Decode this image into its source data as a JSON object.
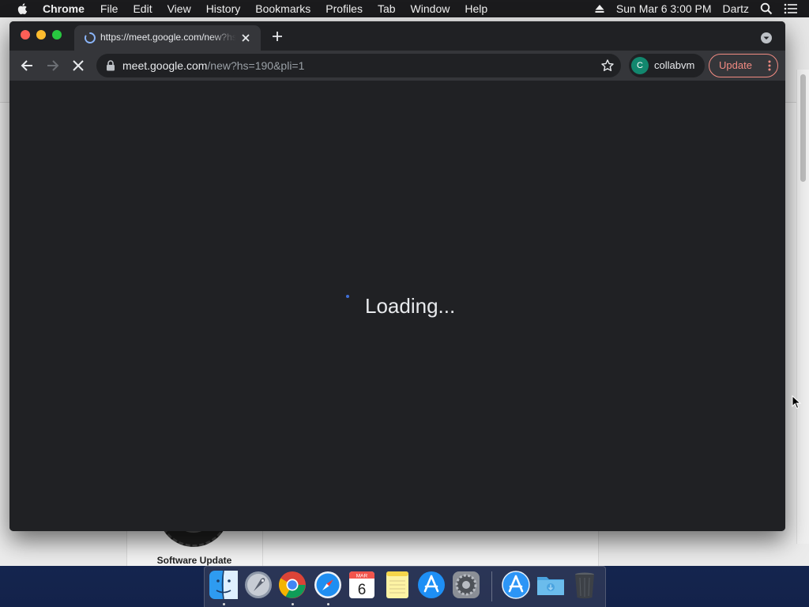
{
  "menubar": {
    "app_name": "Chrome",
    "items": [
      "File",
      "Edit",
      "View",
      "History",
      "Bookmarks",
      "Profiles",
      "Tab",
      "Window",
      "Help"
    ],
    "clock": "Sun Mar 6  3:00 PM",
    "user": "Dartz"
  },
  "browser": {
    "tab": {
      "title": "https://meet.google.com/new?hs=190&pli=1"
    },
    "omnibox": {
      "host": "meet.google.com",
      "path": "/new?hs=190&pli=1"
    },
    "profile": {
      "initial": "C",
      "name": "collabvm"
    },
    "update_label": "Update",
    "page": {
      "loading_text": "Loading..."
    }
  },
  "background_window": {
    "label": "Software Update"
  },
  "dock": {
    "calendar": {
      "month": "MAR",
      "day": "6"
    },
    "apps": [
      "finder-icon",
      "launchpad-icon",
      "chrome-icon",
      "safari-icon",
      "calendar-icon",
      "notes-icon",
      "app-store-icon",
      "system-preferences-icon",
      "app-store-icon",
      "downloads-folder-icon",
      "trash-icon"
    ]
  },
  "colors": {
    "chrome_frame": "#202124",
    "chrome_toolbar": "#35363a",
    "update_accent": "#f28b82",
    "profile_avatar": "#12876e",
    "spinner": "#3f6fd8"
  }
}
